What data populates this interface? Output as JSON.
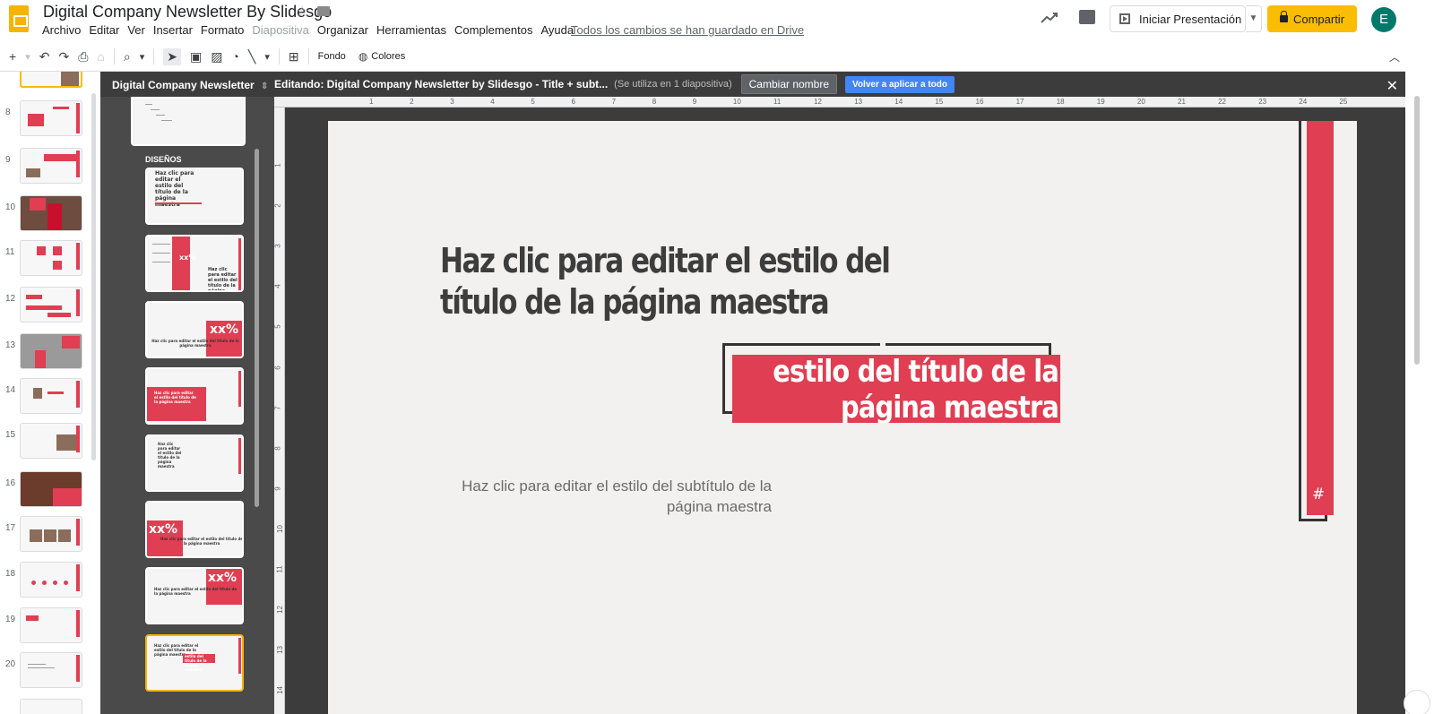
{
  "header": {
    "doc_title": "Digital Company Newsletter By Slidesgo",
    "save_status": "Todos los cambios se han guardado en Drive",
    "present_label": "Iniciar Presentación",
    "share_label": "Compartir",
    "avatar_letter": "E"
  },
  "menu": [
    {
      "label": "Archivo",
      "disabled": false
    },
    {
      "label": "Editar",
      "disabled": false
    },
    {
      "label": "Ver",
      "disabled": false
    },
    {
      "label": "Insertar",
      "disabled": false
    },
    {
      "label": "Formato",
      "disabled": false
    },
    {
      "label": "Diapositiva",
      "disabled": true
    },
    {
      "label": "Organizar",
      "disabled": false
    },
    {
      "label": "Herramientas",
      "disabled": false
    },
    {
      "label": "Complementos",
      "disabled": false
    },
    {
      "label": "Ayuda",
      "disabled": false
    }
  ],
  "toolbar": {
    "fondo_label": "Fondo",
    "colores_label": "Colores"
  },
  "filmstrip": {
    "slide_numbers": [
      "8",
      "9",
      "10",
      "11",
      "12",
      "13",
      "14",
      "15",
      "16",
      "17",
      "18",
      "19",
      "20"
    ]
  },
  "layouts_panel": {
    "title": "Digital Company Newsletter",
    "section_label": "DISEÑOS",
    "layout_1_text": "Haz clic para editar el estilo del título de la página maestra",
    "layout_2_title": "Haz clic para editar el estilo del título de la página maestra",
    "layout_2_overlay": "xx%",
    "layout_3_text": "Haz clic para editar el estilo del título de la página maestra",
    "layout_3_badge": "xx%",
    "layout_4_text": "Haz clic para editar el estilo del título de la página maestra",
    "layout_5_text": "Haz clic para editar el estilo del título de la página maestra",
    "layout_6_badge": "xx%",
    "layout_6_text": "Haz clic para editar el estilo del título de la página maestra",
    "layout_7_badge": "xx%",
    "layout_7_text": "Haz clic para editar el estilo del título de la página maestra",
    "layout_8_text": "Haz clic para editar el estilo del título de la página maestra",
    "layout_8_banner": "estilo del título de la página maestra"
  },
  "edit_bar": {
    "editing_label": "Editando: Digital Company Newsletter by Slidesgo - Title + subt...",
    "usage": "(Se utiliza en 1 diapositiva)",
    "rename_label": "Cambiar nombre",
    "reapply_label": "Volver a aplicar a todo",
    "close_glyph": "✕"
  },
  "rulers": {
    "horizontal": [
      "1",
      "2",
      "3",
      "4",
      "5",
      "6",
      "7",
      "8",
      "9",
      "10",
      "11",
      "12",
      "13",
      "14",
      "15",
      "16",
      "17",
      "18",
      "19",
      "20",
      "21",
      "22",
      "23",
      "24",
      "25"
    ],
    "vertical": [
      "1",
      "2",
      "3",
      "4",
      "5",
      "6",
      "7",
      "8",
      "9",
      "10",
      "11",
      "12",
      "13",
      "14"
    ]
  },
  "slide": {
    "title": "Haz clic para editar el estilo del título de la página maestra",
    "banner_line1": "estilo del título de la",
    "banner_line2": "página maestra",
    "subtitle": "Haz clic para editar el estilo del subtítulo de la página maestra",
    "slide_number_glyph": "#"
  },
  "colors": {
    "accent_red": "#e03e52",
    "share_yellow": "#fbbc04",
    "reapply_blue": "#4285f4",
    "avatar_green": "#00796b"
  }
}
